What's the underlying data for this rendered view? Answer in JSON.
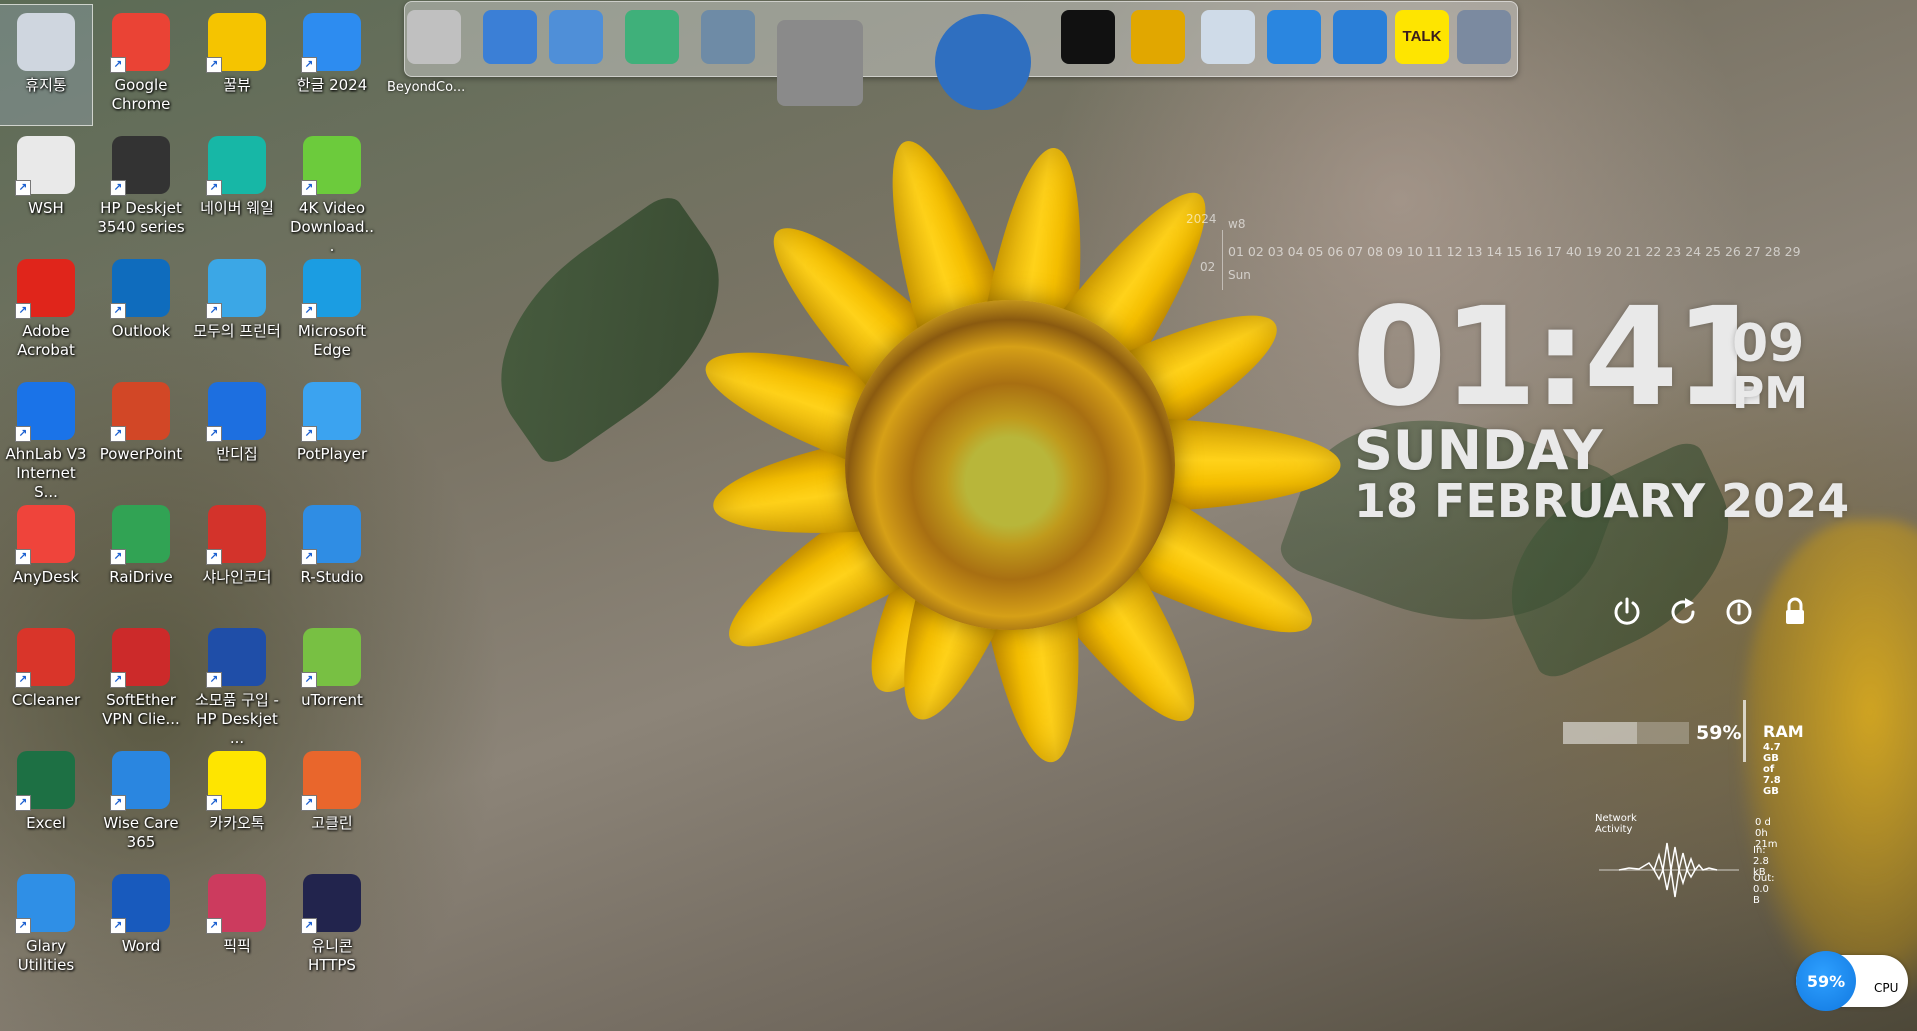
{
  "desktop": {
    "icons": [
      {
        "label": "휴지통",
        "icon": "recycle-bin-icon",
        "color": "#cfd6df",
        "selected": true
      },
      {
        "label": "Google Chrome",
        "icon": "chrome-icon",
        "color": "#ea4335"
      },
      {
        "label": "꿀뷰",
        "icon": "honeyview-icon",
        "color": "#f5c400"
      },
      {
        "label": "한글 2024",
        "icon": "hangul-icon",
        "color": "#2d8cf0"
      },
      {
        "label": "WSH",
        "icon": "wsh-file-icon",
        "color": "#e9e9e9"
      },
      {
        "label": "HP Deskjet 3540 series",
        "icon": "printer-icon",
        "color": "#333333"
      },
      {
        "label": "네이버 웨일",
        "icon": "whale-icon",
        "color": "#17b7a6"
      },
      {
        "label": "4K Video Download...",
        "icon": "download-cloud-icon",
        "color": "#6ccb3c"
      },
      {
        "label": "Adobe Acrobat",
        "icon": "acrobat-icon",
        "color": "#e0251b"
      },
      {
        "label": "Outlook",
        "icon": "outlook-icon",
        "color": "#0f6cbd"
      },
      {
        "label": "모두의 프린터",
        "icon": "modu-printer-icon",
        "color": "#3ba7e6"
      },
      {
        "label": "Microsoft Edge",
        "icon": "edge-icon",
        "color": "#1b9de2"
      },
      {
        "label": "AhnLab V3 Internet S...",
        "icon": "ahnlab-icon",
        "color": "#1a73e8"
      },
      {
        "label": "PowerPoint",
        "icon": "powerpoint-icon",
        "color": "#d24726"
      },
      {
        "label": "반디집",
        "icon": "bandizip-icon",
        "color": "#1d6fe0"
      },
      {
        "label": "PotPlayer",
        "icon": "potplayer-icon",
        "color": "#3ba3f0"
      },
      {
        "label": "AnyDesk",
        "icon": "anydesk-icon",
        "color": "#ef443b"
      },
      {
        "label": "RaiDrive",
        "icon": "raidrive-icon",
        "color": "#31a354"
      },
      {
        "label": "샤나인코더",
        "icon": "shana-encoder-icon",
        "color": "#d3332b"
      },
      {
        "label": "R-Studio",
        "icon": "r-studio-icon",
        "color": "#2f8de4"
      },
      {
        "label": "CCleaner",
        "icon": "ccleaner-icon",
        "color": "#d9352a"
      },
      {
        "label": "SoftEther VPN Clie...",
        "icon": "softether-icon",
        "color": "#cc2a2a"
      },
      {
        "label": "소모품 구입 - HP Deskjet ...",
        "icon": "hp-supplies-icon",
        "color": "#1f4ea8"
      },
      {
        "label": "uTorrent",
        "icon": "utorrent-icon",
        "color": "#78c043"
      },
      {
        "label": "Excel",
        "icon": "excel-icon",
        "color": "#1d7044"
      },
      {
        "label": "Wise Care 365",
        "icon": "wise-care-icon",
        "color": "#2a86e0"
      },
      {
        "label": "카카오톡",
        "icon": "kakaotalk-icon",
        "color": "#fee500"
      },
      {
        "label": "고클린",
        "icon": "goclean-icon",
        "color": "#e9662c"
      },
      {
        "label": "Glary Utilities",
        "icon": "glary-icon",
        "color": "#2f8fe6"
      },
      {
        "label": "Word",
        "icon": "word-icon",
        "color": "#185abd"
      },
      {
        "label": "픽픽",
        "icon": "picpick-icon",
        "color": "#cc3b5e"
      },
      {
        "label": "유니콘 HTTPS",
        "icon": "unicorn-https-icon",
        "color": "#22244d"
      }
    ]
  },
  "dock": {
    "items": [
      {
        "icon": "beyondcompare-icon",
        "label": "BeyondCo..."
      },
      {
        "icon": "globe-network-icon"
      },
      {
        "icon": "folder-icon"
      },
      {
        "icon": "folder-green-icon"
      },
      {
        "icon": "folder-gear-icon"
      },
      {
        "icon": "tools-icon"
      },
      {
        "icon": "world-globe-icon"
      },
      {
        "icon": "tshirt-icon"
      },
      {
        "icon": "magic-hammer-icon"
      },
      {
        "icon": "trash-icon"
      },
      {
        "icon": "glary-moon-icon"
      },
      {
        "icon": "wise-shield-icon"
      },
      {
        "icon": "kakaotalk-icon",
        "text": "TALK"
      },
      {
        "icon": "registry-icon"
      }
    ]
  },
  "calendar": {
    "year": "2024",
    "week": "w8",
    "month": "02",
    "days": "01 02 03 04 05 06 07 08 09 10 11 12 13 14 15 16 17 40 19 20 21 22 23 24 25 26 27 28 29",
    "today_dayname": "Sun"
  },
  "clock": {
    "time": "01:41",
    "seconds": "09",
    "ampm": "PM",
    "day": "SUNDAY",
    "date": "18 FEBRUARY   2024"
  },
  "power_buttons": [
    "power-icon",
    "restart-icon",
    "logoff-icon",
    "lock-icon"
  ],
  "ram": {
    "percent_text": "59%",
    "percent_value": 0.59,
    "title": "RAM",
    "used": "4.7 GB",
    "total": "of 7.8 GB"
  },
  "network": {
    "title": "Network Activity",
    "uptime": "0 d 0h 21m",
    "in": "In: 2.8 kB",
    "out": "Out: 0.0 B"
  },
  "cpu": {
    "percent_text": "59%",
    "label": "CPU"
  }
}
